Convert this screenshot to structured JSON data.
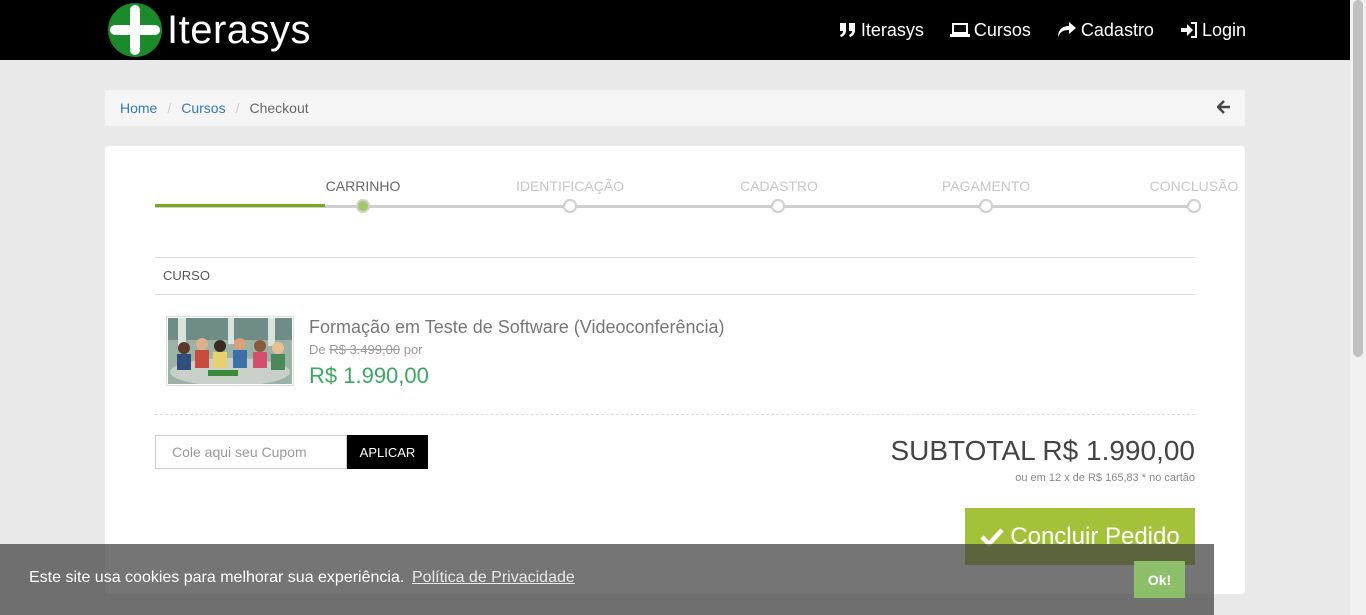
{
  "header": {
    "brand": "Iterasys",
    "nav": [
      {
        "label": "Iterasys",
        "icon": "quote-icon"
      },
      {
        "label": "Cursos",
        "icon": "laptop-icon"
      },
      {
        "label": "Cadastro",
        "icon": "share-arrow-icon"
      },
      {
        "label": "Login",
        "icon": "sign-in-icon"
      }
    ]
  },
  "breadcrumb": {
    "items": [
      "Home",
      "Cursos"
    ],
    "current": "Checkout"
  },
  "steps": {
    "labels": [
      "CARRINHO",
      "IDENTIFICAÇÃO",
      "CADASTRO",
      "PAGAMENTO",
      "CONCLUSÃO"
    ],
    "active_index": 0
  },
  "cart": {
    "column_header": "CURSO",
    "item": {
      "title": "Formação em Teste de Software (Videoconferência)",
      "price_prefix": "De",
      "old_price": "R$ 3.499,00",
      "price_suffix": "por",
      "new_price": "R$ 1.990,00"
    },
    "coupon_placeholder": "Cole aqui seu Cupom",
    "coupon_button": "APLICAR",
    "subtotal": "SUBTOTAL R$ 1.990,00",
    "installments": "ou em 12 x de R$ 165,83 * no cartão",
    "conclude_button": "Concluir Pedido"
  },
  "cookie": {
    "text": "Este site usa cookies para melhorar sua experiência.",
    "link": "Política de Privacidade",
    "ok": "Ok!"
  },
  "colors": {
    "accent_green": "#a4c239",
    "price_green": "#3aa860",
    "progress_green": "#7aa81e",
    "link_blue": "#337ab7"
  }
}
